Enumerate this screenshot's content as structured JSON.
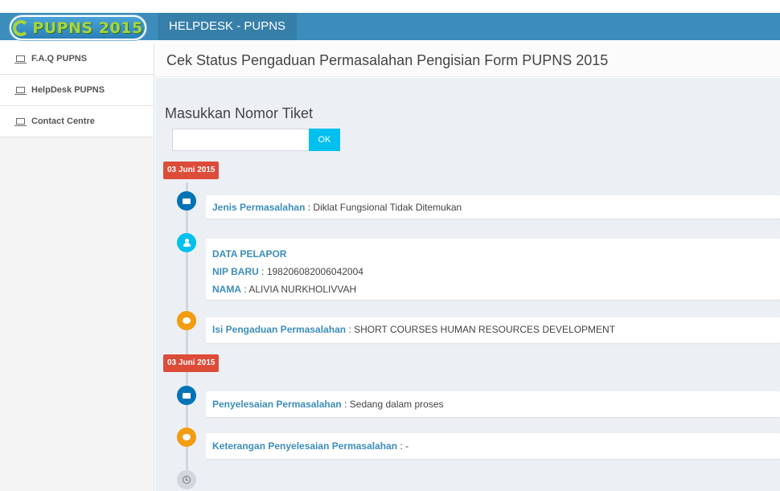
{
  "header": {
    "logo_text": "PUPNS 2015",
    "brand": "HELPDESK - PUPNS"
  },
  "sidebar": {
    "items": [
      {
        "label": "F.A.Q PUPNS",
        "icon": "monitor-icon"
      },
      {
        "label": "HelpDesk PUPNS",
        "icon": "monitor-icon"
      },
      {
        "label": "Contact Centre",
        "icon": "monitor-icon"
      }
    ]
  },
  "page": {
    "title": "Cek Status Pengaduan Permasalahan Pengisian Form PUPNS 2015"
  },
  "search": {
    "label": "Masukkan Nomor Tiket",
    "value": "",
    "placeholder": "",
    "button": "OK"
  },
  "timeline": {
    "date1": "03 Juni 2015",
    "date2": "03 Juni 2015",
    "jenis": {
      "key": "Jenis Permasalahan",
      "value": "Diklat Fungsional Tidak Ditemukan"
    },
    "pelapor": {
      "heading": "DATA PELAPOR",
      "nip_key": "NIP BARU",
      "nip_value": "198206082006042004",
      "nama_key": "NAMA",
      "nama_value": "ALIVIA NURKHOLIVVAH"
    },
    "isi": {
      "key": "Isi Pengaduan Permasalahan",
      "value": "SHORT COURSES HUMAN RESOURCES DEVELOPMENT"
    },
    "penyelesaian": {
      "key": "Penyelesaian Permasalahan",
      "value": "Sedang dalam proses"
    },
    "keterangan": {
      "key": "Keterangan Penyelesaian Permasalahan",
      "value": "-"
    }
  },
  "colors": {
    "header_blue": "#3c8dbc",
    "brand_blue": "#367fa9",
    "date_red": "#dd4b39",
    "icon_blue": "#0073b7",
    "icon_aqua": "#00c0ef",
    "icon_yellow": "#f39c12"
  }
}
